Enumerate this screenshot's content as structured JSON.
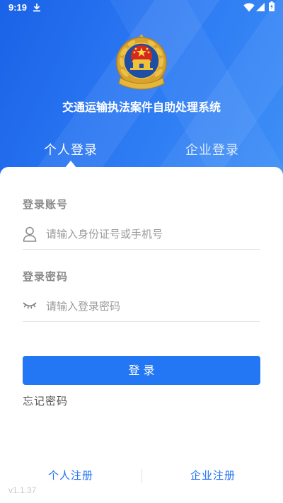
{
  "status_bar": {
    "time": "9:19",
    "left_icons": [
      "download-icon"
    ],
    "right_icons": [
      "wifi-icon",
      "signal-icon",
      "battery-icon"
    ]
  },
  "header": {
    "logo_icon": "police-emblem",
    "title": "交通运输执法案件自助处理系统"
  },
  "tabs": [
    {
      "label": "个人登录",
      "active": true
    },
    {
      "label": "企业登录",
      "active": false
    }
  ],
  "form": {
    "account": {
      "label": "登录账号",
      "icon": "user-icon",
      "placeholder": "请输入身份证号或手机号",
      "value": ""
    },
    "password": {
      "label": "登录密码",
      "icon": "eye-closed-icon",
      "placeholder": "请输入登录密码",
      "value": ""
    },
    "login_button": "登 录",
    "forgot_password": "忘记密码"
  },
  "footer": {
    "register_personal": "个人注册",
    "register_enterprise": "企业注册",
    "version": "v1.1.37"
  },
  "colors": {
    "header_blue": "#2070f0",
    "accent": "#2376f4",
    "link": "#1e6ff0",
    "label_gray": "#8a8a8a",
    "placeholder_gray": "#9a9a9a"
  }
}
